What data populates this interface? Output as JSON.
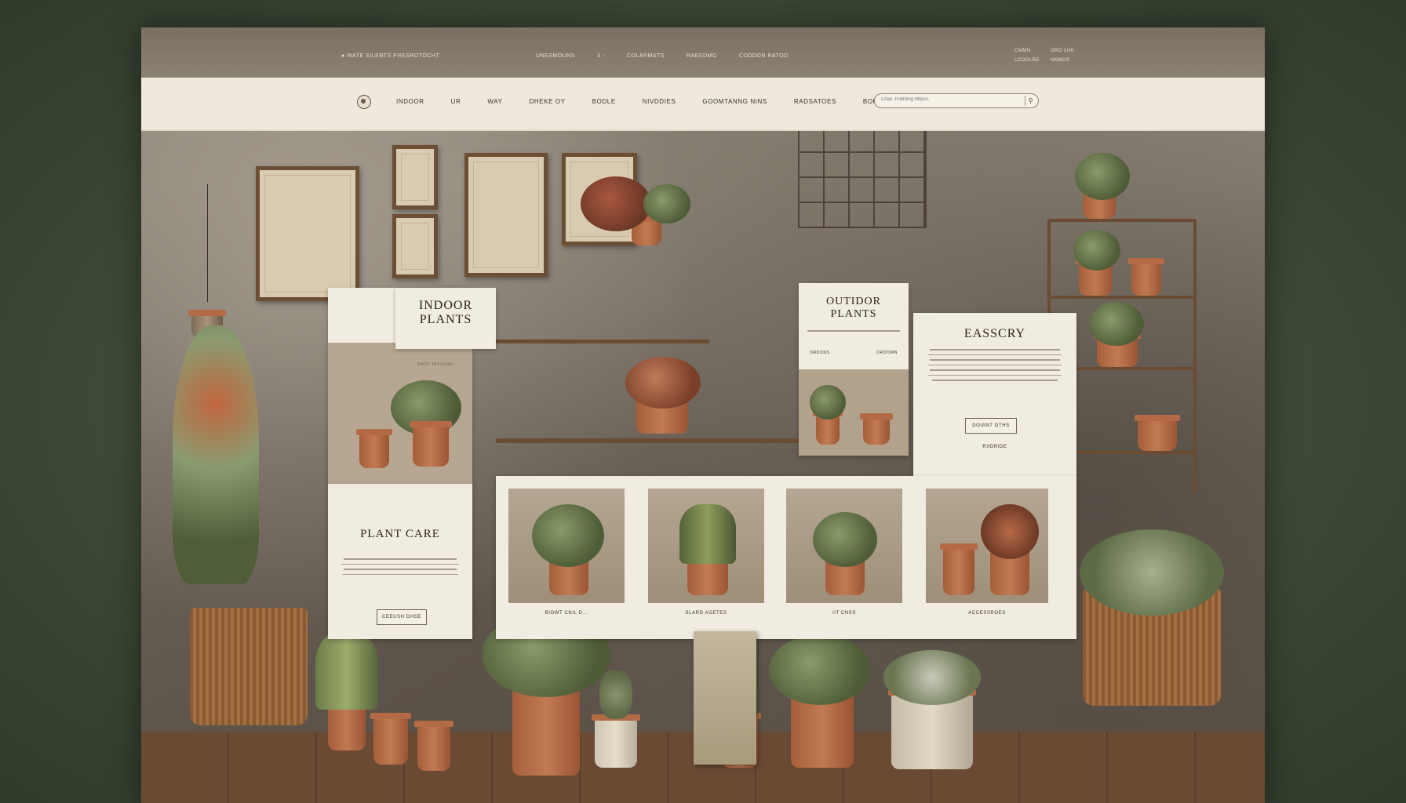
{
  "topbar": {
    "promo": "● WATE SILENTS PRESROTOCHT",
    "links": [
      "UNESMOUNS",
      "3 ◦",
      "COLARMSTS",
      "RAESDMG",
      "CODDON RATOD"
    ],
    "account": [
      "CMMN",
      "ORO LHK",
      "LCODLRE",
      "NNMOS"
    ]
  },
  "nav": {
    "items": [
      "INDOOR",
      "UR",
      "WAY",
      "DHEKE OY",
      "BODLE",
      "NIVDDIES",
      "GOOMTANNG NINS",
      "RADSATOES",
      "BORCONGS"
    ],
    "search_placeholder": "Chan. Pulthting Nttpss.",
    "search_button": "⚲"
  },
  "cards": {
    "indoor": {
      "title_line1": "INDOOR",
      "title_line2": "PLANTS",
      "subtitle": "SHOP INTERNAL"
    },
    "outdoor": {
      "title_line1": "OUTIDOR",
      "title_line2": "PLANTS",
      "left_tag": "ORDONS",
      "right_tag": "ORDOWN"
    },
    "accessory": {
      "title": "EASSCRY",
      "button": "DOIANT OTHS",
      "caption": "RXDRIDE"
    },
    "plant_care": {
      "title": "PLANT CARE",
      "button": "CEEUSH DHSE"
    }
  },
  "tiles": [
    {
      "caption": "BIOWT CNIL D..."
    },
    {
      "caption": "SLARD AGETES"
    },
    {
      "caption": "IIT CNSS"
    },
    {
      "caption": "ACCESSROES"
    }
  ],
  "colors": {
    "accent": "#a55e3a",
    "card": "#f1ece1",
    "frame_bg": "#3d4a37"
  }
}
